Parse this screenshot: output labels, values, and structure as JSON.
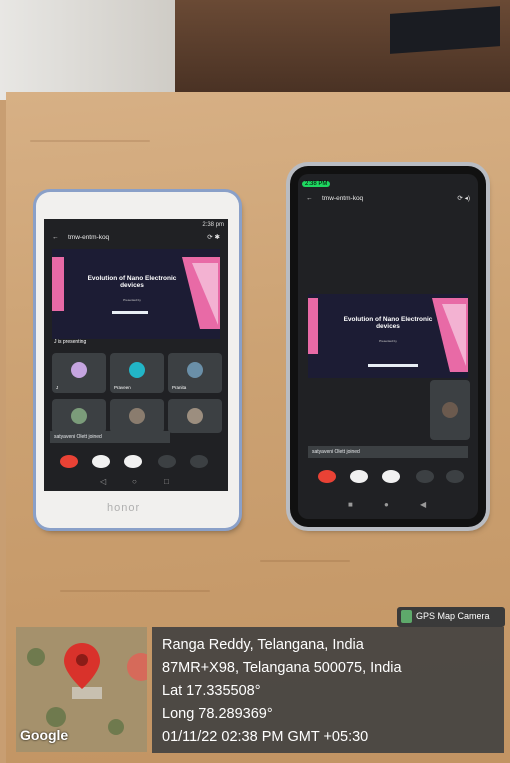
{
  "phone_left": {
    "brand": "honor",
    "meeting_code": "tmw-entm-koq",
    "slide_title": "Evolution of Nano Electronic devices",
    "presenting_label": "J is presenting",
    "participants": [
      "J",
      "Praveen",
      "Pranita"
    ],
    "toast": "satyaveni Olett joined"
  },
  "phone_right": {
    "status_time": "2:38 PM",
    "meeting_code": "tmw-entm-koq",
    "slide_title": "Evolution of Nano Electronic devices",
    "toast": "satyaveni Olett joined"
  },
  "gps": {
    "app_label": "GPS Map Camera",
    "google_label": "Google",
    "location": "Ranga Reddy, Telangana, India",
    "address": "87MR+X98, Telangana 500075, India",
    "lat": "Lat 17.335508°",
    "long": "Long 78.289369°",
    "timestamp": "01/11/22 02:38 PM GMT +05:30"
  },
  "colors": {
    "end_call": "#e94235",
    "meet_bg": "#202124",
    "slide_pink": "#e86aa6",
    "map_pin": "#d9322b"
  }
}
